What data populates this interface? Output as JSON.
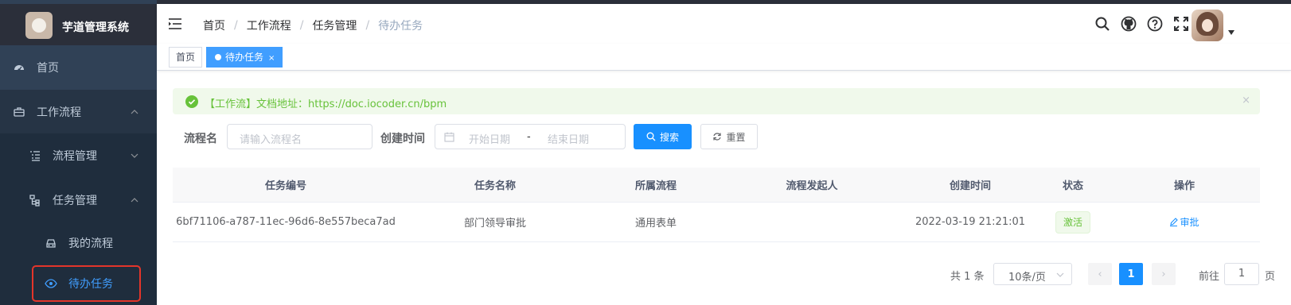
{
  "app": {
    "title": "芋道管理系统"
  },
  "colors": {
    "accent": "#1890ff",
    "sidebar_bg": "#304156",
    "success": "#67c23a",
    "highlight_box": "#e4352a"
  },
  "sidebar": {
    "items": [
      {
        "label": "首页",
        "icon": "dashboard-icon"
      },
      {
        "label": "工作流程",
        "icon": "briefcase-icon",
        "expanded": true
      },
      {
        "label": "流程管理",
        "icon": "list-icon",
        "expanded": false
      },
      {
        "label": "任务管理",
        "icon": "tree-icon",
        "expanded": true
      },
      {
        "label": "我的流程",
        "icon": "car-icon"
      },
      {
        "label": "待办任务",
        "icon": "eye-icon",
        "active": true
      }
    ]
  },
  "breadcrumb": [
    "首页",
    "工作流程",
    "任务管理",
    "待办任务"
  ],
  "tags": {
    "home": "首页",
    "active": "待办任务",
    "close": "×"
  },
  "alert": {
    "text": "【工作流】文档地址：https://doc.iocoder.cn/bpm",
    "close": "×"
  },
  "form": {
    "name_label": "流程名",
    "name_placeholder": "请输入流程名",
    "time_label": "创建时间",
    "start_placeholder": "开始日期",
    "range_sep": "-",
    "end_placeholder": "结束日期",
    "search_button": "搜索",
    "reset_button": "重置"
  },
  "table": {
    "columns": [
      "任务编号",
      "任务名称",
      "所属流程",
      "流程发起人",
      "创建时间",
      "状态",
      "操作"
    ],
    "rows": [
      {
        "id": "6bf71106-a787-11ec-96d6-8e557beca7ad",
        "name": "部门领导审批",
        "process": "通用表单",
        "initiator": "",
        "created": "2022-03-19 21:21:01",
        "status": "激活",
        "action": "审批"
      }
    ]
  },
  "pagination": {
    "total": "共 1 条",
    "page_size": "10条/页",
    "prev": "‹",
    "current": "1",
    "next": "›",
    "goto_label": "前往",
    "goto_value": "1",
    "goto_suffix": "页"
  }
}
